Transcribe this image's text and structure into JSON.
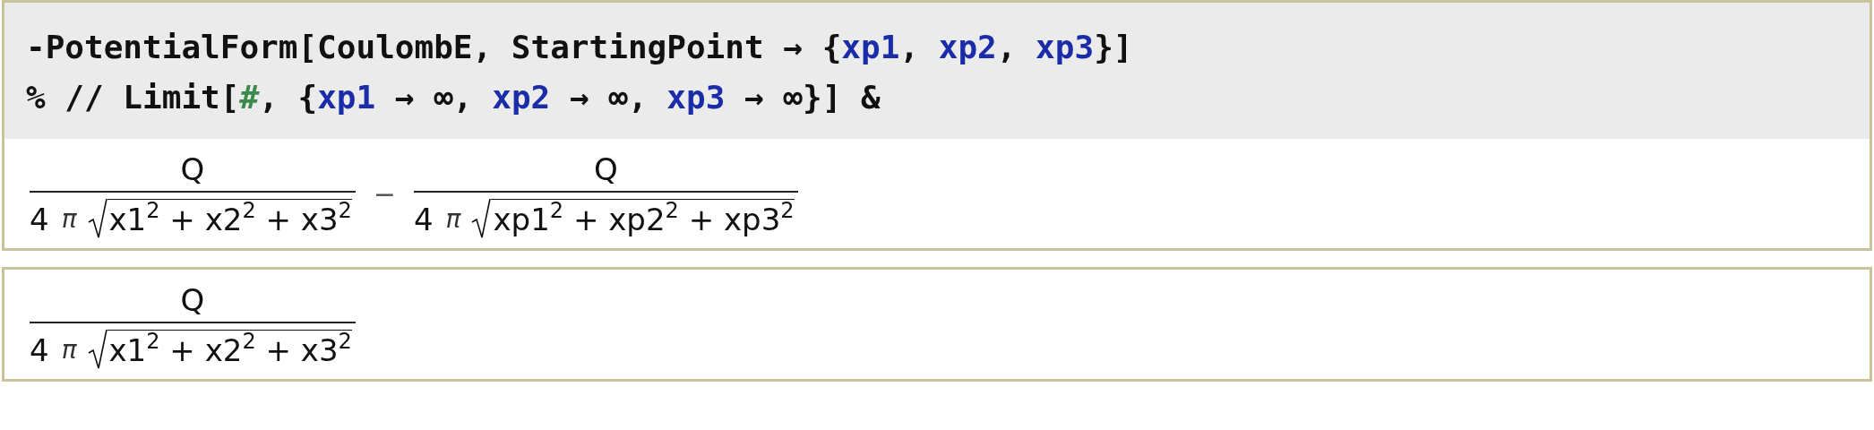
{
  "input_cell": {
    "lines": [
      [
        {
          "kind": "code",
          "text": "-PotentialForm[CoulombE, StartingPoint → {"
        },
        {
          "kind": "symbol",
          "text": "xp1"
        },
        {
          "kind": "code",
          "text": ", "
        },
        {
          "kind": "symbol",
          "text": "xp2"
        },
        {
          "kind": "code",
          "text": ", "
        },
        {
          "kind": "symbol",
          "text": "xp3"
        },
        {
          "kind": "code",
          "text": "}]"
        }
      ],
      [
        {
          "kind": "code",
          "text": "% // Limit["
        },
        {
          "kind": "slot",
          "text": "#"
        },
        {
          "kind": "code",
          "text": ", {"
        },
        {
          "kind": "symbol",
          "text": "xp1"
        },
        {
          "kind": "code",
          "text": " → ∞, "
        },
        {
          "kind": "symbol",
          "text": "xp2"
        },
        {
          "kind": "code",
          "text": " → ∞, "
        },
        {
          "kind": "symbol",
          "text": "xp3"
        },
        {
          "kind": "code",
          "text": " → ∞}] &"
        }
      ]
    ]
  },
  "output_cells": [
    {
      "terms": [
        {
          "kind": "fraction",
          "numerator": "Q",
          "coefficient": "4",
          "constant": "π",
          "radicand": "x1$^{2}$ + x2$^{2}$ + x3$^{2}$"
        },
        {
          "kind": "operator",
          "text": "−"
        },
        {
          "kind": "fraction",
          "numerator": "Q",
          "coefficient": "4",
          "constant": "π",
          "radicand": "xp1$^{2}$ + xp2$^{2}$ + xp3$^{2}$"
        }
      ]
    },
    {
      "terms": [
        {
          "kind": "fraction",
          "numerator": "Q",
          "coefficient": "4",
          "constant": "π",
          "radicand": "x1$^{2}$ + x2$^{2}$ + x3$^{2}$"
        }
      ]
    }
  ]
}
